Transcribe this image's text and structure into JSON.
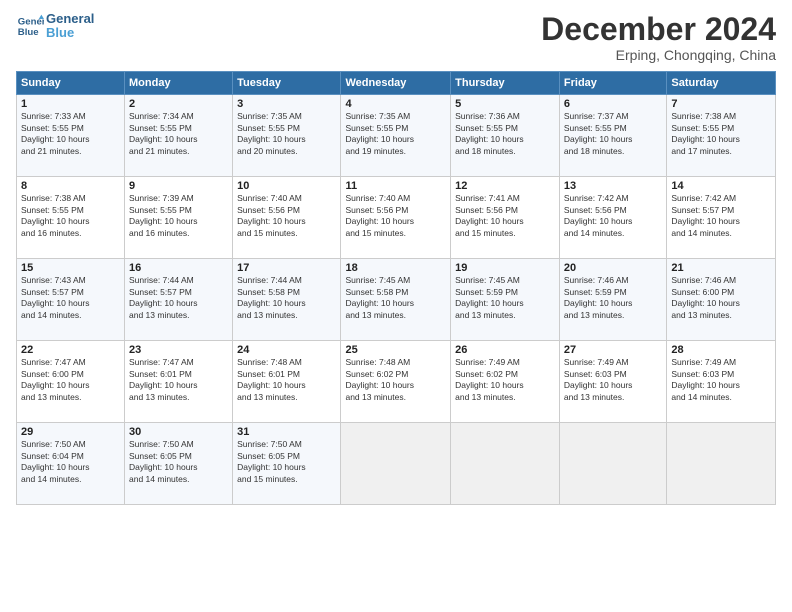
{
  "header": {
    "logo_line1": "General",
    "logo_line2": "Blue",
    "month": "December 2024",
    "location": "Erping, Chongqing, China"
  },
  "weekdays": [
    "Sunday",
    "Monday",
    "Tuesday",
    "Wednesday",
    "Thursday",
    "Friday",
    "Saturday"
  ],
  "weeks": [
    [
      {
        "day": "1",
        "info": "Sunrise: 7:33 AM\nSunset: 5:55 PM\nDaylight: 10 hours\nand 21 minutes."
      },
      {
        "day": "2",
        "info": "Sunrise: 7:34 AM\nSunset: 5:55 PM\nDaylight: 10 hours\nand 21 minutes."
      },
      {
        "day": "3",
        "info": "Sunrise: 7:35 AM\nSunset: 5:55 PM\nDaylight: 10 hours\nand 20 minutes."
      },
      {
        "day": "4",
        "info": "Sunrise: 7:35 AM\nSunset: 5:55 PM\nDaylight: 10 hours\nand 19 minutes."
      },
      {
        "day": "5",
        "info": "Sunrise: 7:36 AM\nSunset: 5:55 PM\nDaylight: 10 hours\nand 18 minutes."
      },
      {
        "day": "6",
        "info": "Sunrise: 7:37 AM\nSunset: 5:55 PM\nDaylight: 10 hours\nand 18 minutes."
      },
      {
        "day": "7",
        "info": "Sunrise: 7:38 AM\nSunset: 5:55 PM\nDaylight: 10 hours\nand 17 minutes."
      }
    ],
    [
      {
        "day": "8",
        "info": "Sunrise: 7:38 AM\nSunset: 5:55 PM\nDaylight: 10 hours\nand 16 minutes."
      },
      {
        "day": "9",
        "info": "Sunrise: 7:39 AM\nSunset: 5:55 PM\nDaylight: 10 hours\nand 16 minutes."
      },
      {
        "day": "10",
        "info": "Sunrise: 7:40 AM\nSunset: 5:56 PM\nDaylight: 10 hours\nand 15 minutes."
      },
      {
        "day": "11",
        "info": "Sunrise: 7:40 AM\nSunset: 5:56 PM\nDaylight: 10 hours\nand 15 minutes."
      },
      {
        "day": "12",
        "info": "Sunrise: 7:41 AM\nSunset: 5:56 PM\nDaylight: 10 hours\nand 15 minutes."
      },
      {
        "day": "13",
        "info": "Sunrise: 7:42 AM\nSunset: 5:56 PM\nDaylight: 10 hours\nand 14 minutes."
      },
      {
        "day": "14",
        "info": "Sunrise: 7:42 AM\nSunset: 5:57 PM\nDaylight: 10 hours\nand 14 minutes."
      }
    ],
    [
      {
        "day": "15",
        "info": "Sunrise: 7:43 AM\nSunset: 5:57 PM\nDaylight: 10 hours\nand 14 minutes."
      },
      {
        "day": "16",
        "info": "Sunrise: 7:44 AM\nSunset: 5:57 PM\nDaylight: 10 hours\nand 13 minutes."
      },
      {
        "day": "17",
        "info": "Sunrise: 7:44 AM\nSunset: 5:58 PM\nDaylight: 10 hours\nand 13 minutes."
      },
      {
        "day": "18",
        "info": "Sunrise: 7:45 AM\nSunset: 5:58 PM\nDaylight: 10 hours\nand 13 minutes."
      },
      {
        "day": "19",
        "info": "Sunrise: 7:45 AM\nSunset: 5:59 PM\nDaylight: 10 hours\nand 13 minutes."
      },
      {
        "day": "20",
        "info": "Sunrise: 7:46 AM\nSunset: 5:59 PM\nDaylight: 10 hours\nand 13 minutes."
      },
      {
        "day": "21",
        "info": "Sunrise: 7:46 AM\nSunset: 6:00 PM\nDaylight: 10 hours\nand 13 minutes."
      }
    ],
    [
      {
        "day": "22",
        "info": "Sunrise: 7:47 AM\nSunset: 6:00 PM\nDaylight: 10 hours\nand 13 minutes."
      },
      {
        "day": "23",
        "info": "Sunrise: 7:47 AM\nSunset: 6:01 PM\nDaylight: 10 hours\nand 13 minutes."
      },
      {
        "day": "24",
        "info": "Sunrise: 7:48 AM\nSunset: 6:01 PM\nDaylight: 10 hours\nand 13 minutes."
      },
      {
        "day": "25",
        "info": "Sunrise: 7:48 AM\nSunset: 6:02 PM\nDaylight: 10 hours\nand 13 minutes."
      },
      {
        "day": "26",
        "info": "Sunrise: 7:49 AM\nSunset: 6:02 PM\nDaylight: 10 hours\nand 13 minutes."
      },
      {
        "day": "27",
        "info": "Sunrise: 7:49 AM\nSunset: 6:03 PM\nDaylight: 10 hours\nand 13 minutes."
      },
      {
        "day": "28",
        "info": "Sunrise: 7:49 AM\nSunset: 6:03 PM\nDaylight: 10 hours\nand 14 minutes."
      }
    ],
    [
      {
        "day": "29",
        "info": "Sunrise: 7:50 AM\nSunset: 6:04 PM\nDaylight: 10 hours\nand 14 minutes."
      },
      {
        "day": "30",
        "info": "Sunrise: 7:50 AM\nSunset: 6:05 PM\nDaylight: 10 hours\nand 14 minutes."
      },
      {
        "day": "31",
        "info": "Sunrise: 7:50 AM\nSunset: 6:05 PM\nDaylight: 10 hours\nand 15 minutes."
      },
      {
        "day": "",
        "info": ""
      },
      {
        "day": "",
        "info": ""
      },
      {
        "day": "",
        "info": ""
      },
      {
        "day": "",
        "info": ""
      }
    ]
  ]
}
